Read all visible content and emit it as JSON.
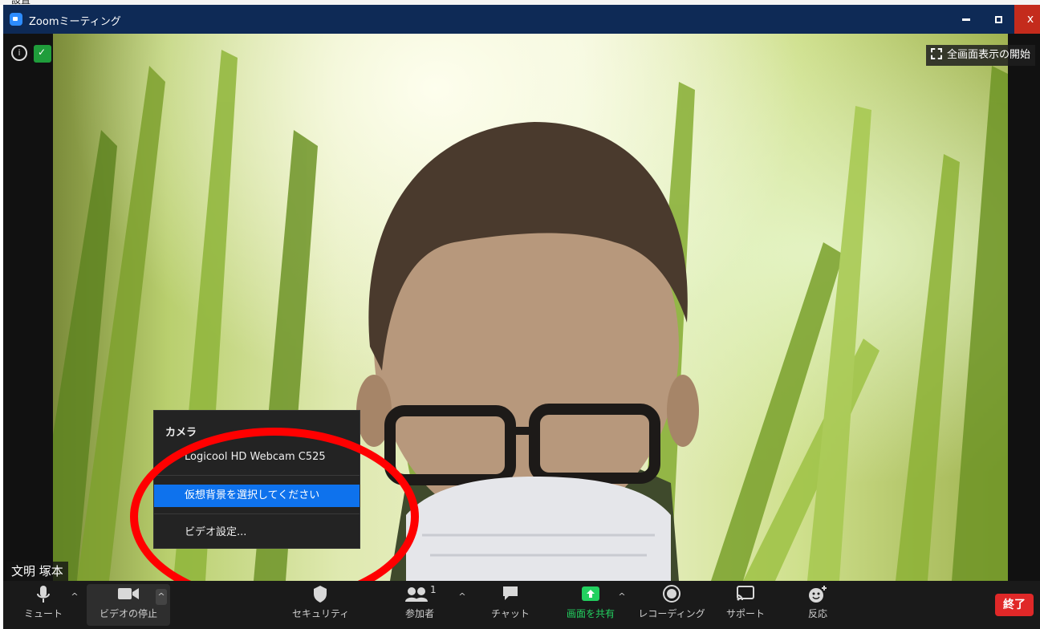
{
  "window": {
    "title": "Zoomミーティング",
    "controls": {
      "minimize": "minimize",
      "maximize": "maximize",
      "close": "x"
    }
  },
  "background_fragment": "設置",
  "video": {
    "fullscreen_label": "全画面表示の開始",
    "participant_name": "文明 塚本"
  },
  "camera_menu": {
    "header": "カメラ",
    "items": [
      {
        "label": "Logicool HD Webcam C525",
        "checked": true
      },
      {
        "label": "仮想背景を選択してください",
        "highlighted": true
      },
      {
        "label": "ビデオ設定..."
      }
    ]
  },
  "toolbar": {
    "mute": "ミュート",
    "video_stop": "ビデオの停止",
    "security": "セキュリティ",
    "participants": "参加者",
    "participants_count": "1",
    "chat": "チャット",
    "share": "画面を共有",
    "recording": "レコーディング",
    "support": "サポート",
    "reactions": "反応",
    "end": "終了"
  },
  "colors": {
    "titlebar": "#0e2a56",
    "accent_blue": "#0e72ed",
    "share_green": "#23d160",
    "end_red": "#e02828",
    "annotation_red": "#ff0000"
  },
  "icons": {
    "mic": "microphone-icon",
    "camera": "video-camera-icon",
    "security": "shield-icon",
    "participants": "people-icon",
    "chat": "chat-bubble-icon",
    "share": "share-arrow-icon",
    "record": "record-circle-icon",
    "support": "cast-screen-icon",
    "reactions": "emoji-plus-icon"
  }
}
